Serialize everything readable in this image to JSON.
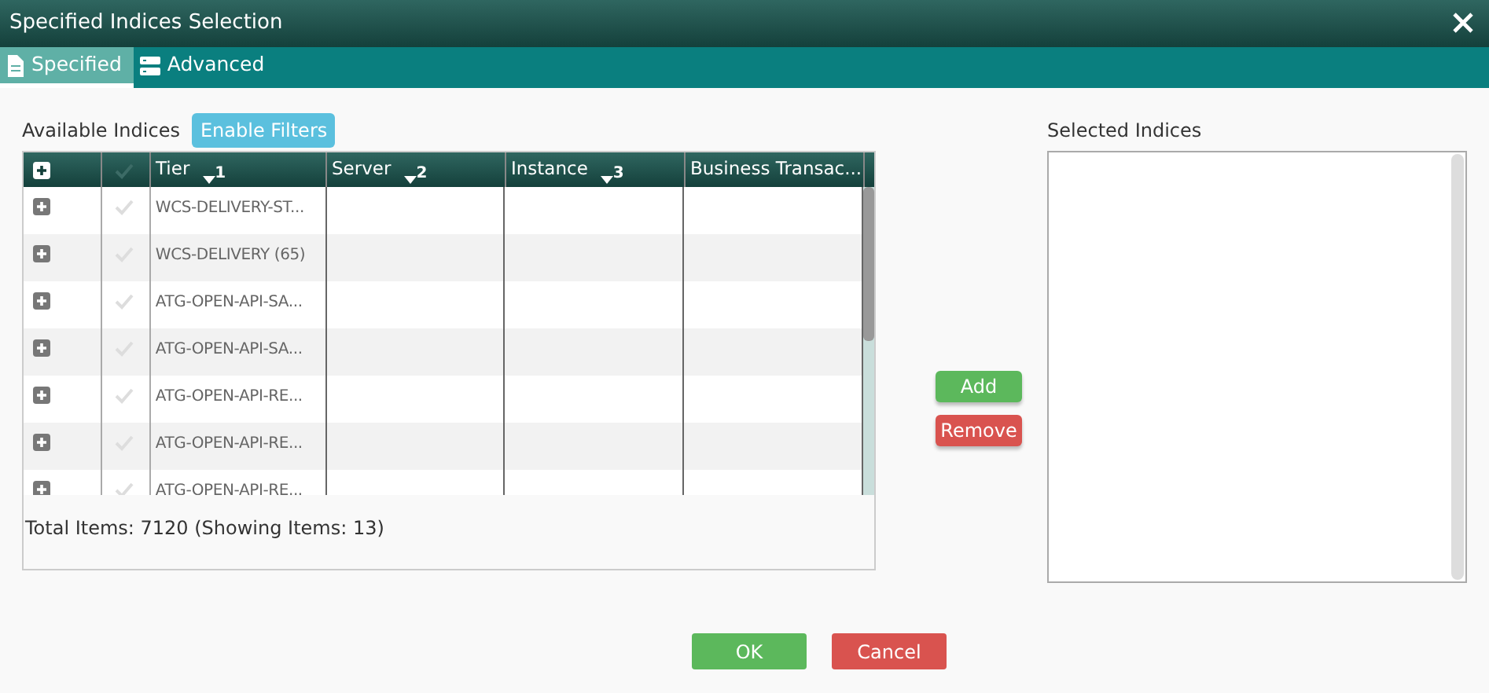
{
  "window": {
    "title": "Specified Indices Selection"
  },
  "tabs": [
    {
      "label": "Specified",
      "selected": true
    },
    {
      "label": "Advanced",
      "selected": false
    }
  ],
  "available": {
    "label": "Available Indices",
    "filter_button": "Enable Filters",
    "columns": [
      {
        "label": "Tier",
        "sort": "1"
      },
      {
        "label": "Server",
        "sort": "2"
      },
      {
        "label": "Instance",
        "sort": "3"
      },
      {
        "label": "Business Transac..."
      }
    ],
    "rows": [
      {
        "tier": "WCS-DELIVERY-ST...",
        "checked": false
      },
      {
        "tier": "WCS-DELIVERY (65)",
        "checked": false
      },
      {
        "tier": "ATG-OPEN-API-SA...",
        "checked": false
      },
      {
        "tier": "ATG-OPEN-API-SA...",
        "checked": false
      },
      {
        "tier": "ATG-OPEN-API-RE...",
        "checked": false
      },
      {
        "tier": "ATG-OPEN-API-RE...",
        "checked": false
      },
      {
        "tier": "ATG-OPEN-API-RE...",
        "checked": false
      }
    ],
    "footer": "Total Items: 7120 (Showing Items: 13)"
  },
  "add_button": "Add",
  "remove_button": "Remove",
  "selected": {
    "label": "Selected Indices"
  },
  "buttons": [
    {
      "label": "OK",
      "kind": "ok"
    },
    {
      "label": "Cancel",
      "kind": "cancel"
    }
  ]
}
